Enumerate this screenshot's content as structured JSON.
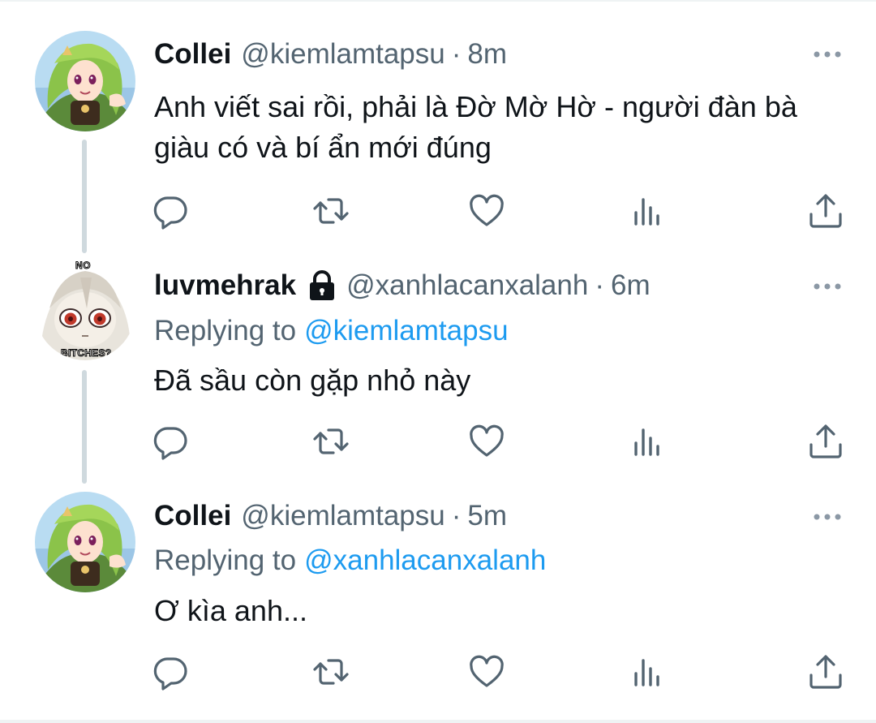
{
  "tweets": [
    {
      "display_name": "Collei",
      "handle": "@kiemlamtapsu",
      "separator": "·",
      "time": "8m",
      "replying_to_label": "",
      "replying_to_handle": "",
      "text": "Anh viết sai rồi, phải là Đờ Mờ Hờ - người đàn bà giàu có và bí ẩn mới đúng",
      "avatar_icon": "collei-avatar",
      "locked": false
    },
    {
      "display_name": "luvmehrak",
      "handle": "@xanhlacanxalanh",
      "separator": "·",
      "time": "6m",
      "replying_to_label": "Replying to",
      "replying_to_handle": "@kiemlamtapsu",
      "text": "Đã sầu còn gặp nhỏ này",
      "avatar_icon": "plush-avatar",
      "avatar_caption_top": "NO",
      "avatar_caption_bottom": "BITCHES?",
      "locked": true
    },
    {
      "display_name": "Collei",
      "handle": "@kiemlamtapsu",
      "separator": "·",
      "time": "5m",
      "replying_to_label": "Replying to",
      "replying_to_handle": "@xanhlacanxalanh",
      "text": "Ơ kìa anh...",
      "avatar_icon": "collei-avatar",
      "locked": false
    }
  ],
  "action_icons": [
    "reply-icon",
    "retweet-icon",
    "like-icon",
    "views-icon",
    "share-icon"
  ],
  "colors": {
    "text": "#0f1419",
    "secondary": "#536471",
    "link": "#1d9bf0",
    "thread_line": "#cfd9de",
    "divider": "#eff3f4"
  }
}
